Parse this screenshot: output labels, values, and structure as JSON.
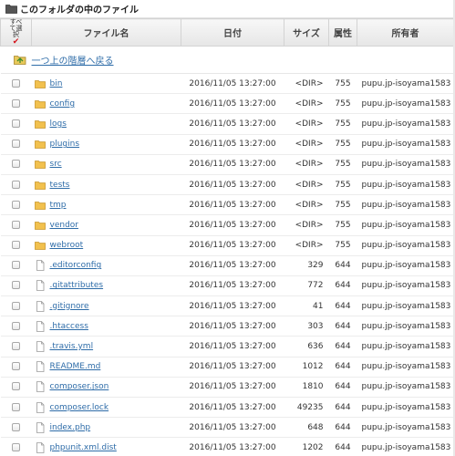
{
  "panel": {
    "title": "このフォルダの中のファイル"
  },
  "table": {
    "select_all_label": "すべて選択",
    "select_all_mark": "✔",
    "columns": {
      "name": "ファイル名",
      "date": "日付",
      "size": "サイズ",
      "perm": "属性",
      "owner": "所有者"
    }
  },
  "up_link": {
    "label": "一つ上の階層へ戻る"
  },
  "colors": {
    "link": "#2e6ca8",
    "folder": "#f2c14e",
    "check": "#d4141c"
  },
  "files": [
    {
      "name": "bin",
      "type": "folder-icon",
      "date": "2016/11/05 13:27:00",
      "size": "<DIR>",
      "perm": "755",
      "owner": "pupu.jp-isoyama1583"
    },
    {
      "name": "config",
      "type": "folder-icon",
      "date": "2016/11/05 13:27:00",
      "size": "<DIR>",
      "perm": "755",
      "owner": "pupu.jp-isoyama1583"
    },
    {
      "name": "logs",
      "type": "folder-icon",
      "date": "2016/11/05 13:27:00",
      "size": "<DIR>",
      "perm": "755",
      "owner": "pupu.jp-isoyama1583"
    },
    {
      "name": "plugins",
      "type": "folder-icon",
      "date": "2016/11/05 13:27:00",
      "size": "<DIR>",
      "perm": "755",
      "owner": "pupu.jp-isoyama1583"
    },
    {
      "name": "src",
      "type": "folder-icon",
      "date": "2016/11/05 13:27:00",
      "size": "<DIR>",
      "perm": "755",
      "owner": "pupu.jp-isoyama1583"
    },
    {
      "name": "tests",
      "type": "folder-icon",
      "date": "2016/11/05 13:27:00",
      "size": "<DIR>",
      "perm": "755",
      "owner": "pupu.jp-isoyama1583"
    },
    {
      "name": "tmp",
      "type": "folder-icon",
      "date": "2016/11/05 13:27:00",
      "size": "<DIR>",
      "perm": "755",
      "owner": "pupu.jp-isoyama1583"
    },
    {
      "name": "vendor",
      "type": "folder-icon",
      "date": "2016/11/05 13:27:00",
      "size": "<DIR>",
      "perm": "755",
      "owner": "pupu.jp-isoyama1583"
    },
    {
      "name": "webroot",
      "type": "folder-icon",
      "date": "2016/11/05 13:27:00",
      "size": "<DIR>",
      "perm": "755",
      "owner": "pupu.jp-isoyama1583"
    },
    {
      "name": ".editorconfig",
      "type": "file-icon",
      "date": "2016/11/05 13:27:00",
      "size": "329",
      "perm": "644",
      "owner": "pupu.jp-isoyama1583"
    },
    {
      "name": ".gitattributes",
      "type": "file-icon",
      "date": "2016/11/05 13:27:00",
      "size": "772",
      "perm": "644",
      "owner": "pupu.jp-isoyama1583"
    },
    {
      "name": ".gitignore",
      "type": "file-icon",
      "date": "2016/11/05 13:27:00",
      "size": "41",
      "perm": "644",
      "owner": "pupu.jp-isoyama1583"
    },
    {
      "name": ".htaccess",
      "type": "file-icon",
      "date": "2016/11/05 13:27:00",
      "size": "303",
      "perm": "644",
      "owner": "pupu.jp-isoyama1583"
    },
    {
      "name": ".travis.yml",
      "type": "file-icon",
      "date": "2016/11/05 13:27:00",
      "size": "636",
      "perm": "644",
      "owner": "pupu.jp-isoyama1583"
    },
    {
      "name": "README.md",
      "type": "file-icon",
      "date": "2016/11/05 13:27:00",
      "size": "1012",
      "perm": "644",
      "owner": "pupu.jp-isoyama1583"
    },
    {
      "name": "composer.json",
      "type": "file-icon",
      "date": "2016/11/05 13:27:00",
      "size": "1810",
      "perm": "644",
      "owner": "pupu.jp-isoyama1583"
    },
    {
      "name": "composer.lock",
      "type": "file-icon",
      "date": "2016/11/05 13:27:00",
      "size": "49235",
      "perm": "644",
      "owner": "pupu.jp-isoyama1583"
    },
    {
      "name": "index.php",
      "type": "file-icon",
      "date": "2016/11/05 13:27:00",
      "size": "648",
      "perm": "644",
      "owner": "pupu.jp-isoyama1583"
    },
    {
      "name": "phpunit.xml.dist",
      "type": "file-icon",
      "date": "2016/11/05 13:27:00",
      "size": "1202",
      "perm": "644",
      "owner": "pupu.jp-isoyama1583"
    }
  ]
}
